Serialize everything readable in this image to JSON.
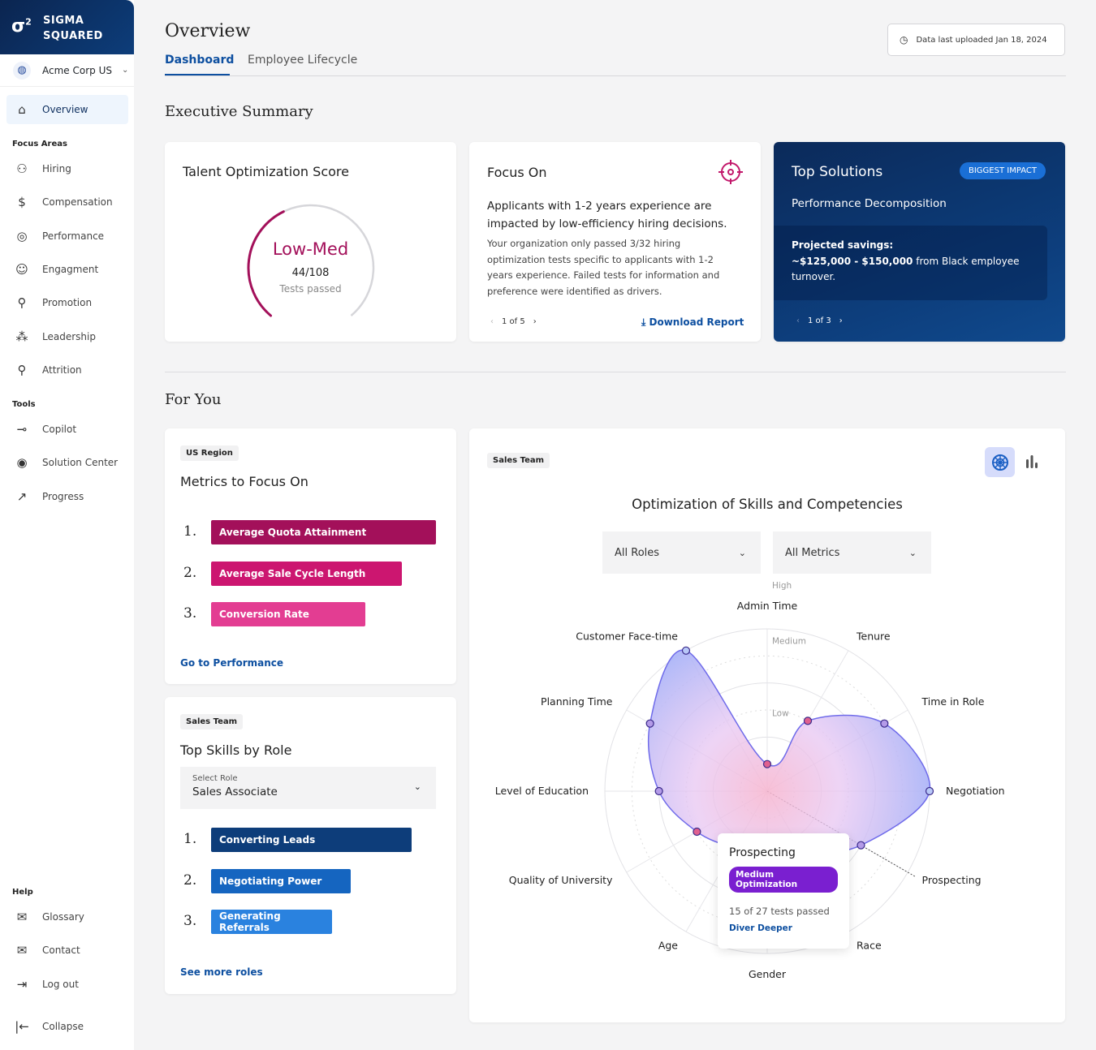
{
  "brand": {
    "logo": "σ",
    "logo_sup": "2",
    "name_line1": "SIGMA",
    "name_line2": "SQUARED"
  },
  "org": {
    "name": "Acme Corp US"
  },
  "sidebar": {
    "overview": "Overview",
    "focus_areas_label": "Focus Areas",
    "focus_areas": [
      {
        "label": "Hiring",
        "icon": "person-add-icon"
      },
      {
        "label": "Compensation",
        "icon": "dollar-icon"
      },
      {
        "label": "Performance",
        "icon": "gauge-icon"
      },
      {
        "label": "Engagment",
        "icon": "smile-icon"
      },
      {
        "label": "Promotion",
        "icon": "person-up-icon"
      },
      {
        "label": "Leadership",
        "icon": "org-chart-icon"
      },
      {
        "label": "Attrition",
        "icon": "person-remove-icon"
      }
    ],
    "tools_label": "Tools",
    "tools": [
      {
        "label": "Copilot",
        "icon": "copilot-icon"
      },
      {
        "label": "Solution Center",
        "icon": "target-icon"
      },
      {
        "label": "Progress",
        "icon": "trend-up-icon"
      }
    ],
    "help_label": "Help",
    "help": [
      {
        "label": "Glossary",
        "icon": "book-icon"
      },
      {
        "label": "Contact",
        "icon": "mail-icon"
      },
      {
        "label": "Log out",
        "icon": "logout-icon"
      }
    ],
    "collapse": "Collapse"
  },
  "header": {
    "title": "Overview",
    "tabs": [
      "Dashboard",
      "Employee Lifecycle"
    ],
    "active_tab": "Dashboard",
    "upload_status": "Data last uploaded Jan 18, 2024"
  },
  "exec": {
    "title": "Executive Summary",
    "talent": {
      "title": "Talent Optimization Score",
      "level": "Low-Med",
      "passed": 44,
      "total": 108,
      "score_text": "44/108",
      "caption": "Tests passed",
      "color": "#a3105a"
    },
    "focus": {
      "title": "Focus On",
      "headline": "Applicants with 1-2 years experience are impacted by low-efficiency hiring decisions.",
      "body": "Your organization only passed 3/32 hiring optimization tests specific to applicants with 1-2 years experience. Failed tests for information and preference were identified as drivers.",
      "pager": "1 of 5",
      "download": "Download Report"
    },
    "solutions": {
      "title": "Top Solutions",
      "badge": "BIGGEST IMPACT",
      "subtitle": "Performance Decomposition",
      "savings_label": "Projected savings:",
      "savings_amount": "~$125,000 - $150,000",
      "savings_rest": " from Black employee turnover.",
      "pager": "1 of 3"
    }
  },
  "for_you": {
    "title": "For You",
    "metrics": {
      "chip": "US Region",
      "title": "Metrics to Focus On",
      "items": [
        {
          "n": "1.",
          "label": "Average Quota Attainment",
          "color": "#a3105a"
        },
        {
          "n": "2.",
          "label": "Average Sale Cycle Length",
          "color": "#cc1670"
        },
        {
          "n": "3.",
          "label": "Conversion Rate",
          "color": "#e33d92"
        }
      ],
      "link": "Go to Performance"
    },
    "skills": {
      "chip": "Sales Team",
      "title": "Top Skills by Role",
      "select_label": "Select Role",
      "select_value": "Sales Associate",
      "items": [
        {
          "n": "1.",
          "label": "Converting Leads",
          "color": "#0d3d7a"
        },
        {
          "n": "2.",
          "label": "Negotiating Power",
          "color": "#1565c0"
        },
        {
          "n": "3.",
          "label": "Generating Referrals",
          "color": "#2a82df"
        }
      ],
      "link": "See more roles"
    },
    "radar": {
      "chip": "Sales Team",
      "title": "Optimization of Skills and Competencies",
      "roles_select": "All Roles",
      "metrics_select": "All Metrics",
      "tooltip": {
        "title": "Prospecting",
        "badge": "Medium Optimization",
        "detail": "15 of 27 tests passed",
        "link": "Diver Deeper"
      }
    }
  },
  "chart_data": {
    "type": "radar",
    "title": "Optimization of Skills and Competencies",
    "levels": [
      "Low",
      "Medium",
      "High"
    ],
    "range": [
      0,
      3
    ],
    "categories": [
      "Admin Time",
      "Tenure",
      "Time in Role",
      "Negotiation",
      "Prospecting",
      "Race",
      "Gender",
      "Age",
      "Quality of University",
      "Level of Education",
      "Planning Time",
      "Customer Face-time"
    ],
    "values": [
      0.5,
      1.5,
      2.5,
      3.0,
      2.0,
      1.3,
      1.1,
      1.2,
      1.5,
      2.0,
      2.5,
      3.0
    ],
    "highlighted": "Prospecting"
  }
}
